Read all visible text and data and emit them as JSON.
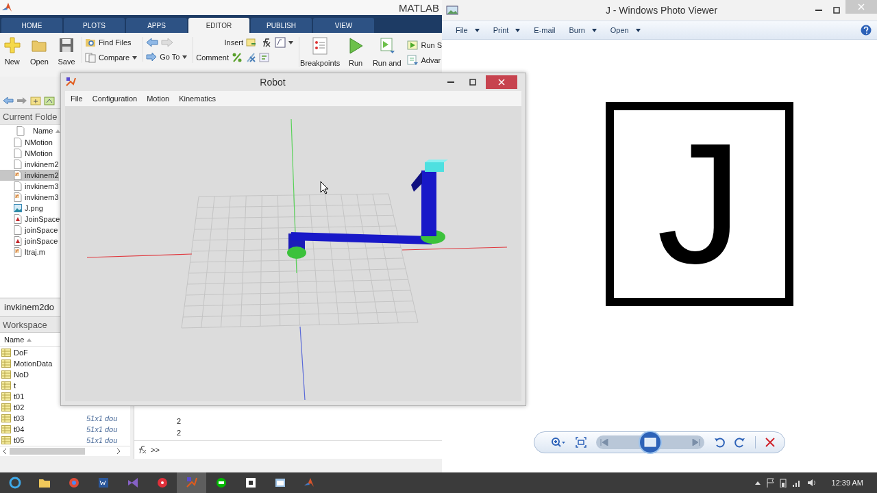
{
  "matlab": {
    "title": "MATLAB",
    "tabs": [
      {
        "label": "HOME",
        "selected": false
      },
      {
        "label": "PLOTS",
        "selected": false
      },
      {
        "label": "APPS",
        "selected": false
      },
      {
        "label": "EDITOR",
        "selected": true
      },
      {
        "label": "PUBLISH",
        "selected": false
      },
      {
        "label": "VIEW",
        "selected": false
      }
    ],
    "toolstrip": {
      "new": "New",
      "open": "Open",
      "save": "Save",
      "find_files": "Find Files",
      "compare": "Compare",
      "go_to": "Go To",
      "insert": "Insert",
      "comment": "Comment",
      "breakpoints": "Breakpoints",
      "run": "Run",
      "run_and_advance": "Run and",
      "run_section": "Run S",
      "advance": "Advar"
    },
    "current_folder": {
      "title": "Current Folde",
      "column": "Name",
      "files": [
        {
          "name": "NMotion",
          "kind": "file",
          "selected": false
        },
        {
          "name": "NMotion",
          "kind": "file",
          "selected": false
        },
        {
          "name": "invkinem2",
          "kind": "file",
          "selected": false
        },
        {
          "name": "invkinem2",
          "kind": "function",
          "selected": true
        },
        {
          "name": "invkinem3",
          "kind": "file",
          "selected": false
        },
        {
          "name": "invkinem3",
          "kind": "function",
          "selected": false
        },
        {
          "name": "J.png",
          "kind": "image",
          "selected": false
        },
        {
          "name": "JoinSpace",
          "kind": "figure",
          "selected": false
        },
        {
          "name": "joinSpace",
          "kind": "file",
          "selected": false
        },
        {
          "name": "joinSpace",
          "kind": "figure",
          "selected": false
        },
        {
          "name": "ltraj.m",
          "kind": "function",
          "selected": false
        }
      ],
      "details": "invkinem2do"
    },
    "workspace": {
      "title": "Workspace",
      "column": "Name",
      "variables": [
        {
          "name": "DoF"
        },
        {
          "name": "MotionData"
        },
        {
          "name": "NoD"
        },
        {
          "name": "t"
        },
        {
          "name": "t01"
        },
        {
          "name": "t02"
        },
        {
          "name": "t03",
          "value": "51x1 dou"
        },
        {
          "name": "t04",
          "value": "51x1 dou"
        },
        {
          "name": "t05",
          "value": "51x1 dou"
        }
      ]
    },
    "command_window": {
      "output": [
        "2",
        "2"
      ],
      "prompt": ">>"
    }
  },
  "robot": {
    "title": "Robot",
    "menu": [
      "File",
      "Configuration",
      "Motion",
      "Kinematics"
    ]
  },
  "photo_viewer": {
    "title": "J - Windows Photo Viewer",
    "menu": [
      {
        "label": "File",
        "dropdown": true
      },
      {
        "label": "Print",
        "dropdown": true
      },
      {
        "label": "E-mail",
        "dropdown": false
      },
      {
        "label": "Burn",
        "dropdown": true
      },
      {
        "label": "Open",
        "dropdown": true
      }
    ],
    "image_text": "J"
  },
  "taskbar": {
    "clock": "12:39 AM"
  }
}
